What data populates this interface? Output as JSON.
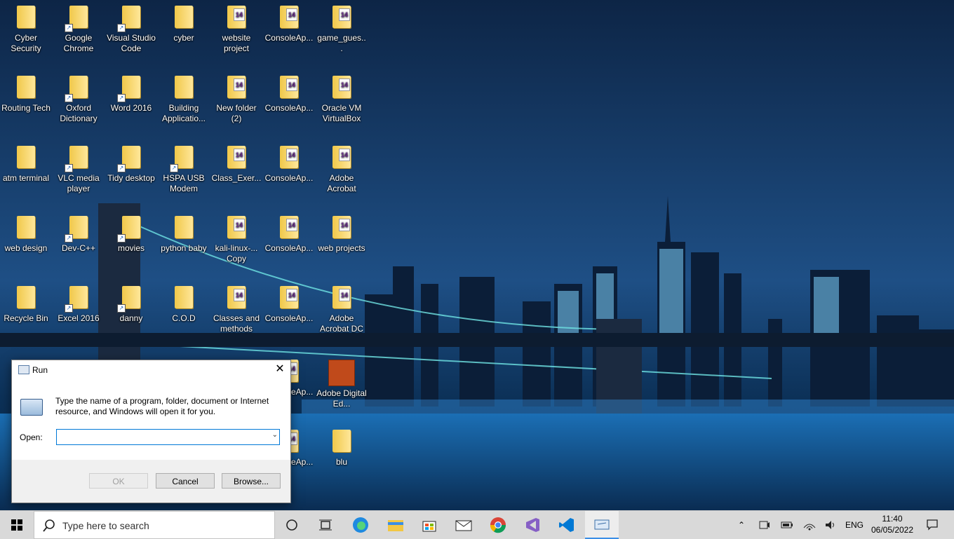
{
  "desktop": {
    "icons": [
      [
        "Cyber Security",
        "Google Chrome",
        "Visual Studio Code",
        "cyber",
        "website project",
        "ConsoleAp...",
        "game_gues..."
      ],
      [
        "Routing Tech",
        "Oxford Dictionary",
        "Word 2016",
        "Building Applicatio...",
        "New folder (2)",
        "ConsoleAp...",
        "Oracle VM VirtualBox"
      ],
      [
        "atm terminal",
        "VLC media player",
        "Tidy desktop",
        "HSPA USB Modem",
        "Class_Exer...",
        "ConsoleAp...",
        "Adobe Acrobat"
      ],
      [
        "web design",
        "Dev-C++",
        "movies",
        "python baby",
        "kali-linux-... Copy",
        "ConsoleAp...",
        "web projects"
      ],
      [
        "Recycle Bin",
        "Excel 2016",
        "danny",
        "C.O.D",
        "Classes and methods",
        "ConsoleAp...",
        "Adobe Acrobat DC"
      ]
    ],
    "partial_icons": {
      "consoleapp_row6": "ConsoleAp...",
      "adobe_digital": "Adobe Digital Ed...",
      "consoleapp_row7": "ConsoleAp...",
      "blu": "blu"
    }
  },
  "run_dialog": {
    "title": "Run",
    "close": "✕",
    "description": "Type the name of a program, folder, document or Internet resource, and Windows will open it for you.",
    "open_label": "Open:",
    "open_value": "",
    "ok": "OK",
    "cancel": "Cancel",
    "browse": "Browse..."
  },
  "taskbar": {
    "search_placeholder": "Type here to search",
    "language": "ENG",
    "time": "11:40",
    "date": "06/05/2022",
    "accent": "#3a8ee6"
  }
}
